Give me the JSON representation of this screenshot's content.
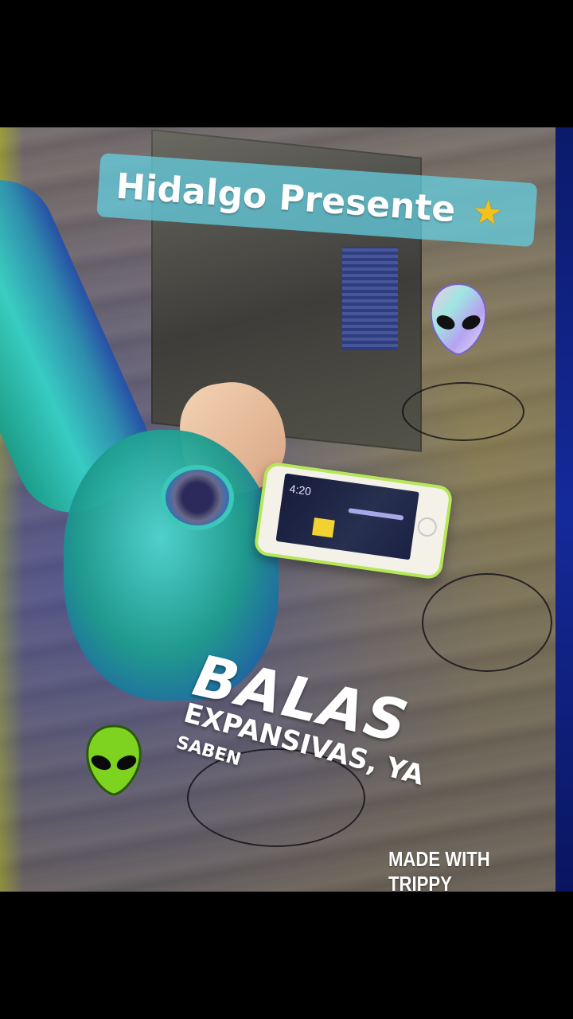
{
  "banner": {
    "title": "Hidalgo Presente",
    "star_icon": "star-icon"
  },
  "caption": {
    "line1": "BALAS",
    "line2": "EXPANSIVAS, YA",
    "line3": "SABEN"
  },
  "phone": {
    "time": "4:20"
  },
  "watermark": "MADE WITH TRIPPY",
  "stickers": [
    "alien-head-icon",
    "alien-head-icon"
  ],
  "colors": {
    "banner_bg": "#64d2e6",
    "alien_green": "#7ed321",
    "bong_teal": "#36d1c6",
    "phone_case": "#b6e65a"
  }
}
